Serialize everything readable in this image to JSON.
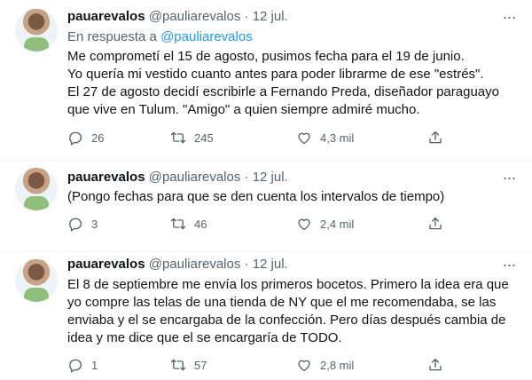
{
  "tweets": [
    {
      "name": "pauarevalos",
      "handle": "@pauliarevalos",
      "sep": "·",
      "date": "12 jul.",
      "reply_prefix": "En respuesta a",
      "reply_to": "@pauliarevalos",
      "text": "Me comprometí el 15 de agosto, pusimos fecha para el 19 de junio.\nYo quería mi vestido cuanto antes para poder librarme de ese \"estrés\".\nEl 27 de agosto decidí escribirle a Fernando Preda, diseñador paraguayo que vive en Tulum. \"Amigo\" a quien siempre admiré mucho.",
      "replies": "26",
      "retweets": "245",
      "likes": "4,3 mil"
    },
    {
      "name": "pauarevalos",
      "handle": "@pauliarevalos",
      "sep": "·",
      "date": "12 jul.",
      "text": "(Pongo fechas para que se den cuenta los intervalos de tiempo)",
      "replies": "3",
      "retweets": "46",
      "likes": "2,4 mil"
    },
    {
      "name": "pauarevalos",
      "handle": "@pauliarevalos",
      "sep": "·",
      "date": "12 jul.",
      "text": "El 8 de septiembre me envía los primeros bocetos. Primero la idea era que yo compre las telas de una tienda de NY que el me recomendaba, se las enviaba y el se encargaba de la confección. Pero días después cambia de idea y me dice que el se encargaría de TODO.",
      "replies": "1",
      "retweets": "57",
      "likes": "2,8 mil"
    }
  ],
  "icons": {
    "reply": "reply-icon",
    "retweet": "retweet-icon",
    "like": "like-icon",
    "share": "share-icon",
    "more": "more-icon"
  },
  "colors": {
    "link": "#1d9bf0",
    "muted": "#536471",
    "text": "#0f1419"
  }
}
